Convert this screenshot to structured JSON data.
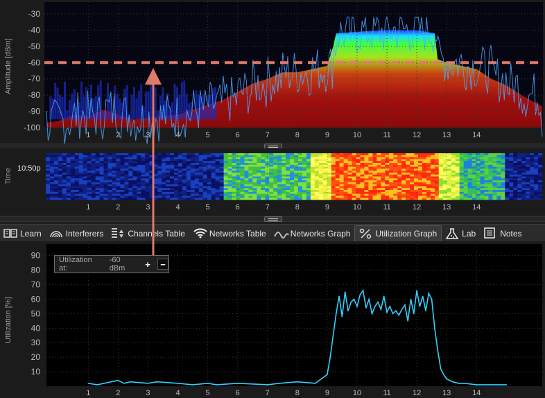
{
  "spectrum": {
    "y_axis_label": "Amplitude [dBm]",
    "y_ticks": [
      "-30",
      "-40",
      "-50",
      "-60",
      "-70",
      "-80",
      "-90",
      "-100"
    ],
    "x_ticks": [
      "1",
      "2",
      "3",
      "4",
      "5",
      "6",
      "7",
      "8",
      "9",
      "10",
      "11",
      "12",
      "13",
      "14"
    ],
    "threshold_dbm": -60,
    "colors": {
      "marker": "#e07a6c",
      "trace": "#4aa8ff"
    }
  },
  "waterfall": {
    "y_axis_label": "Time",
    "time_label": "10:50p",
    "x_ticks": [
      "1",
      "2",
      "3",
      "4",
      "5",
      "6",
      "7",
      "8",
      "9",
      "10",
      "11",
      "12",
      "13",
      "14"
    ]
  },
  "tabs": [
    {
      "label": "Learn",
      "icon": "book-icon"
    },
    {
      "label": "Interferers",
      "icon": "signal-arcs-icon"
    },
    {
      "label": "Channels Table",
      "icon": "table-icon"
    },
    {
      "label": "Networks Table",
      "icon": "wifi-icon"
    },
    {
      "label": "Networks Graph",
      "icon": "wave-icon"
    },
    {
      "label": "Utilization Graph",
      "icon": "percent-icon",
      "active": true
    },
    {
      "label": "Lab",
      "icon": "flask-icon"
    },
    {
      "label": "Notes",
      "icon": "notes-icon"
    }
  ],
  "tooltip": {
    "label": "Utilization at:",
    "value": "-60 dBm",
    "plus": "+",
    "minus": "−"
  },
  "chart_data": {
    "type": "line",
    "xlabel": "",
    "ylabel": "Utilization [%]",
    "x_ticks": [
      "1",
      "2",
      "3",
      "4",
      "5",
      "6",
      "7",
      "8",
      "9",
      "10",
      "11",
      "12",
      "13",
      "14"
    ],
    "y_ticks": [
      "10",
      "20",
      "30",
      "40",
      "50",
      "60",
      "70",
      "80",
      "90"
    ],
    "ylim": [
      0,
      98
    ],
    "xlim": [
      -0.4,
      16.2
    ],
    "grid": true,
    "color": "#33d0ff",
    "x": [
      1.0,
      1.3,
      2.0,
      2.2,
      2.4,
      3.0,
      3.3,
      4.0,
      4.5,
      5.0,
      5.3,
      6.0,
      7.0,
      7.4,
      8.0,
      8.6,
      8.8,
      9.0,
      9.1,
      9.2,
      9.3,
      9.4,
      9.5,
      9.6,
      9.7,
      9.8,
      9.9,
      10.0,
      10.1,
      10.2,
      10.3,
      10.4,
      10.5,
      10.6,
      10.7,
      10.8,
      10.9,
      11.0,
      11.1,
      11.2,
      11.3,
      11.4,
      11.5,
      11.6,
      11.7,
      11.8,
      11.9,
      12.0,
      12.1,
      12.2,
      12.3,
      12.4,
      12.5,
      12.6,
      12.7,
      12.8,
      12.9,
      13.0,
      13.2,
      13.4,
      13.6,
      14.0,
      14.5,
      15.0
    ],
    "values": [
      2,
      1,
      4,
      2,
      3,
      2,
      3,
      2,
      1,
      2,
      1,
      2,
      1,
      2,
      3,
      2,
      5,
      8,
      20,
      35,
      50,
      62,
      48,
      65,
      52,
      58,
      60,
      55,
      63,
      66,
      54,
      60,
      50,
      55,
      58,
      53,
      62,
      51,
      55,
      50,
      52,
      49,
      53,
      56,
      45,
      60,
      50,
      66,
      55,
      62,
      52,
      64,
      60,
      40,
      25,
      12,
      8,
      5,
      3,
      2,
      2,
      1,
      1,
      1
    ]
  }
}
